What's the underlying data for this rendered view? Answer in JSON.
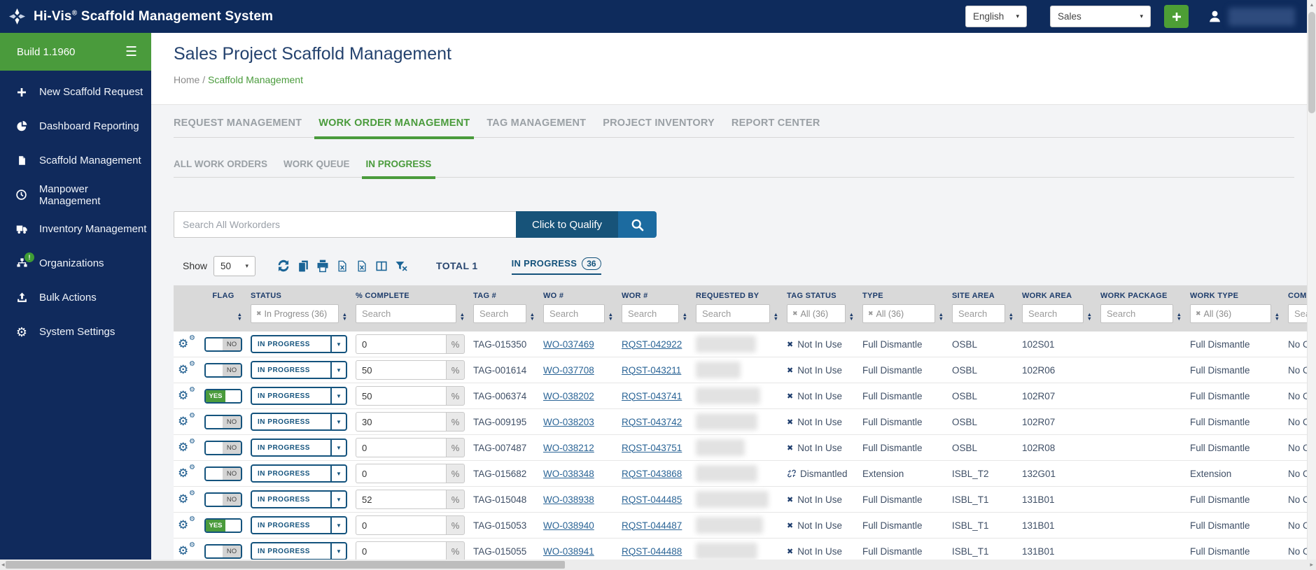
{
  "colors": {
    "navy": "#0e2b5c",
    "green": "#4a9b3c",
    "steel_blue": "#14527b",
    "link_blue": "#2a6496"
  },
  "navbar": {
    "brand_name": "Hi-Vis",
    "brand_reg": "®",
    "brand_rest": " Scaffold Management System",
    "language": "English",
    "role": "Sales",
    "add_button": "+"
  },
  "sidebar": {
    "build": "Build 1.1960",
    "menu_icon": "hamburger-icon",
    "items": [
      {
        "icon": "plus",
        "label": "New Scaffold Request"
      },
      {
        "icon": "pie",
        "label": "Dashboard Reporting"
      },
      {
        "icon": "file",
        "label": "Scaffold Management"
      },
      {
        "icon": "clock",
        "label": "Manpower Management"
      },
      {
        "icon": "truck",
        "label": "Inventory Management"
      },
      {
        "icon": "sitemap",
        "label": "Organizations",
        "badge": "!"
      },
      {
        "icon": "upload",
        "label": "Bulk Actions"
      },
      {
        "icon": "gear",
        "label": "System Settings"
      }
    ]
  },
  "page": {
    "title": "Sales Project Scaffold Management",
    "breadcrumb": {
      "home": "Home",
      "separator": "/",
      "current": "Scaffold Management"
    }
  },
  "tabs": [
    {
      "label": "REQUEST MANAGEMENT",
      "active": false
    },
    {
      "label": "WORK ORDER MANAGEMENT",
      "active": true
    },
    {
      "label": "TAG MANAGEMENT",
      "active": false
    },
    {
      "label": "PROJECT INVENTORY",
      "active": false
    },
    {
      "label": "REPORT CENTER",
      "active": false
    }
  ],
  "subtabs": [
    {
      "label": "ALL WORK ORDERS",
      "active": false
    },
    {
      "label": "WORK QUEUE",
      "active": false
    },
    {
      "label": "IN PROGRESS",
      "active": true
    }
  ],
  "search": {
    "placeholder": "Search All Workorders",
    "qualify_label": "Click to Qualify",
    "icon": "search"
  },
  "toolbar": {
    "show_label": "Show",
    "page_size": "50",
    "icons": [
      "refresh",
      "copy",
      "print",
      "excel",
      "excel2",
      "columns",
      "filter-clear"
    ],
    "total_label": "TOTAL 1",
    "active_filter": {
      "label": "IN PROGRESS",
      "count": "36"
    }
  },
  "table": {
    "columns": [
      {
        "key": "actions",
        "label": "",
        "filter": null,
        "sort": false
      },
      {
        "key": "flag",
        "label": "FLAG",
        "filter": null,
        "sort": true
      },
      {
        "key": "status",
        "label": "STATUS",
        "filter": {
          "type": "chip",
          "value": "In Progress (36)"
        },
        "sort": true
      },
      {
        "key": "pct",
        "label": "% COMPLETE",
        "filter": {
          "type": "search",
          "value": "Search"
        },
        "sort": true
      },
      {
        "key": "tag",
        "label": "TAG #",
        "filter": {
          "type": "search",
          "value": "Search"
        },
        "sort": true
      },
      {
        "key": "wo",
        "label": "WO #",
        "filter": {
          "type": "search",
          "value": "Search"
        },
        "sort": true
      },
      {
        "key": "wor",
        "label": "WOR #",
        "filter": {
          "type": "search",
          "value": "Search"
        },
        "sort": true
      },
      {
        "key": "requested_by",
        "label": "REQUESTED BY",
        "filter": {
          "type": "search",
          "value": "Search"
        },
        "sort": true
      },
      {
        "key": "tag_status",
        "label": "TAG STATUS",
        "filter": {
          "type": "chip",
          "value": "All (36)"
        },
        "sort": true
      },
      {
        "key": "type",
        "label": "TYPE",
        "filter": {
          "type": "chip",
          "value": "All (36)"
        },
        "sort": true
      },
      {
        "key": "site_area",
        "label": "SITE AREA",
        "filter": {
          "type": "search",
          "value": "Search"
        },
        "sort": true
      },
      {
        "key": "work_area",
        "label": "WORK AREA",
        "filter": {
          "type": "search",
          "value": "Search"
        },
        "sort": true
      },
      {
        "key": "work_package",
        "label": "WORK PACKAGE",
        "filter": {
          "type": "search",
          "value": "Search"
        },
        "sort": true
      },
      {
        "key": "work_type",
        "label": "WORK TYPE",
        "filter": {
          "type": "chip",
          "value": "All (36)"
        },
        "sort": true
      },
      {
        "key": "comments",
        "label": "COM",
        "filter": {
          "type": "search",
          "value": "Sea"
        },
        "sort": true
      }
    ],
    "rows": [
      {
        "flag": "NO",
        "status": "IN PROGRESS",
        "pct": "0",
        "tag": "TAG-015350",
        "wo": "WO-037469",
        "wor": "RQST-042922",
        "requested_by_redacted": true,
        "tag_status": {
          "icon": "x-mark",
          "text": "Not In Use"
        },
        "type": "Full Dismantle",
        "site_area": "OSBL",
        "work_area": "102S01",
        "work_package": "",
        "work_type": "Full Dismantle",
        "comments": "No C"
      },
      {
        "flag": "NO",
        "status": "IN PROGRESS",
        "pct": "50",
        "tag": "TAG-001614",
        "wo": "WO-037708",
        "wor": "RQST-043211",
        "requested_by_redacted": true,
        "tag_status": {
          "icon": "x-mark",
          "text": "Not In Use"
        },
        "type": "Full Dismantle",
        "site_area": "OSBL",
        "work_area": "102R06",
        "work_package": "",
        "work_type": "Full Dismantle",
        "comments": "No C"
      },
      {
        "flag": "YES",
        "status": "IN PROGRESS",
        "pct": "50",
        "tag": "TAG-006374",
        "wo": "WO-038202",
        "wor": "RQST-043741",
        "requested_by_redacted": true,
        "tag_status": {
          "icon": "x-mark",
          "text": "Not In Use"
        },
        "type": "Full Dismantle",
        "site_area": "OSBL",
        "work_area": "102R07",
        "work_package": "",
        "work_type": "Full Dismantle",
        "comments": "No C"
      },
      {
        "flag": "NO",
        "status": "IN PROGRESS",
        "pct": "30",
        "tag": "TAG-009195",
        "wo": "WO-038203",
        "wor": "RQST-043742",
        "requested_by_redacted": true,
        "tag_status": {
          "icon": "x-mark",
          "text": "Not In Use"
        },
        "type": "Full Dismantle",
        "site_area": "OSBL",
        "work_area": "102R07",
        "work_package": "",
        "work_type": "Full Dismantle",
        "comments": "No C"
      },
      {
        "flag": "NO",
        "status": "IN PROGRESS",
        "pct": "0",
        "tag": "TAG-007487",
        "wo": "WO-038212",
        "wor": "RQST-043751",
        "requested_by_redacted": true,
        "tag_status": {
          "icon": "x-mark",
          "text": "Not In Use"
        },
        "type": "Full Dismantle",
        "site_area": "OSBL",
        "work_area": "102R08",
        "work_package": "",
        "work_type": "Full Dismantle",
        "comments": "No C"
      },
      {
        "flag": "NO",
        "status": "IN PROGRESS",
        "pct": "0",
        "tag": "TAG-015682",
        "wo": "WO-038348",
        "wor": "RQST-043868",
        "requested_by_redacted": true,
        "tag_status": {
          "icon": "unlink",
          "text": "Dismantled"
        },
        "type": "Extension",
        "site_area": "ISBL_T2",
        "work_area": "132G01",
        "work_package": "",
        "work_type": "Extension",
        "comments": "No C"
      },
      {
        "flag": "NO",
        "status": "IN PROGRESS",
        "pct": "52",
        "tag": "TAG-015048",
        "wo": "WO-038938",
        "wor": "RQST-044485",
        "requested_by_redacted": true,
        "tag_status": {
          "icon": "x-mark",
          "text": "Not In Use"
        },
        "type": "Full Dismantle",
        "site_area": "ISBL_T1",
        "work_area": "131B01",
        "work_package": "",
        "work_type": "Full Dismantle",
        "comments": "No C"
      },
      {
        "flag": "YES",
        "status": "IN PROGRESS",
        "pct": "0",
        "tag": "TAG-015053",
        "wo": "WO-038940",
        "wor": "RQST-044487",
        "requested_by_redacted": true,
        "tag_status": {
          "icon": "x-mark",
          "text": "Not In Use"
        },
        "type": "Full Dismantle",
        "site_area": "ISBL_T1",
        "work_area": "131B01",
        "work_package": "",
        "work_type": "Full Dismantle",
        "comments": "No C"
      },
      {
        "flag": "NO",
        "status": "IN PROGRESS",
        "pct": "0",
        "tag": "TAG-015055",
        "wo": "WO-038941",
        "wor": "RQST-044488",
        "requested_by_redacted": true,
        "tag_status": {
          "icon": "x-mark",
          "text": "Not In Use"
        },
        "type": "Full Dismantle",
        "site_area": "ISBL_T1",
        "work_area": "131B01",
        "work_package": "",
        "work_type": "Full Dismantle",
        "comments": "No C"
      }
    ]
  }
}
